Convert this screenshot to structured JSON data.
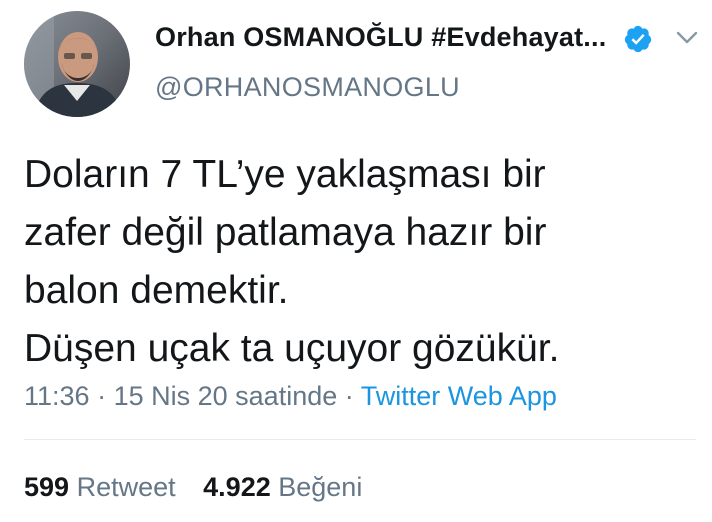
{
  "author": {
    "name": "Orhan OSMANOĞLU #Evdehayat...",
    "handle": "@ORHANOSMANOGLU",
    "verified": true
  },
  "tweet": {
    "lines": [
      "Doların 7 TL’ye yaklaşması bir",
      "zafer değil patlamaya hazır bir",
      "balon demektir.",
      "Düşen uçak ta uçuyor gözükür."
    ],
    "time": "11:36",
    "separator": "·",
    "date": "15 Nis 20 saatinde",
    "source": "Twitter Web App"
  },
  "stats": {
    "retweets_count": "599",
    "retweets_label": "Retweet",
    "likes_count": "4.922",
    "likes_label": "Beğeni"
  },
  "icons": {
    "verified": "verified-badge-icon",
    "menu": "chevron-down-icon"
  },
  "colors": {
    "text": "#14171a",
    "secondary": "#657786",
    "link": "#1b95e0",
    "verified": "#1da1f2",
    "divider": "#e6ecf0"
  }
}
